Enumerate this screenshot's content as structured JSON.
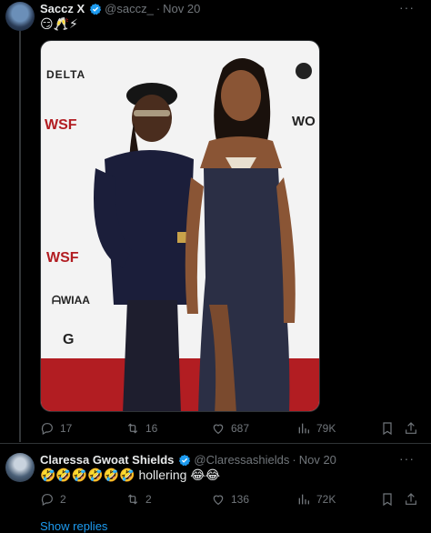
{
  "tweet1": {
    "name": "Saccz X",
    "handle": "@saccz_",
    "dot": "·",
    "date": "Nov 20",
    "text": "😏🥂⚡",
    "media_logos": [
      "DELTA",
      "WSF",
      "WO",
      "WSF",
      "ᗩWIAA",
      "G"
    ],
    "actions": {
      "replies": "17",
      "retweets": "16",
      "likes": "687",
      "views": "79K"
    },
    "more": "···"
  },
  "tweet2": {
    "name": "Claressa Gwoat Shields",
    "handle": "@Claressashields",
    "dot": "·",
    "date": "Nov 20",
    "text": "🤣🤣🤣🤣🤣🤣 hollering 😂😂",
    "actions": {
      "replies": "2",
      "retweets": "2",
      "likes": "136",
      "views": "72K"
    },
    "more": "···"
  },
  "show_replies": "Show replies",
  "colors": {
    "background": "#000000",
    "accent": "#1d9bf0",
    "muted": "#71767b",
    "text": "#e7e9ea"
  }
}
